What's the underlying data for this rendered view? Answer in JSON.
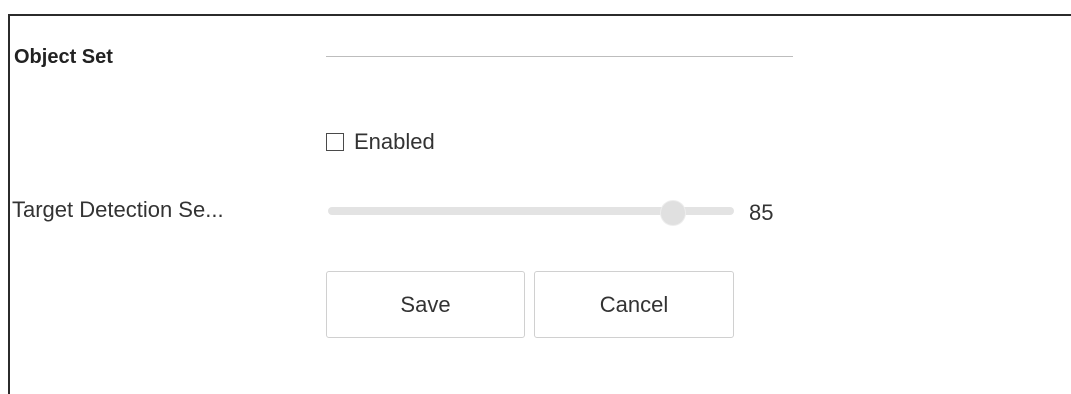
{
  "section": {
    "title": "Object Set"
  },
  "enabled": {
    "label": "Enabled",
    "checked": false
  },
  "sensitivity": {
    "label": "Target Detection Se...",
    "value": "85",
    "level": 85,
    "min": 0,
    "max": 100
  },
  "buttons": {
    "save": "Save",
    "cancel": "Cancel"
  },
  "colors": {
    "track": "#e3e3e3",
    "thumb": "#e0e0e0",
    "button_border": "#d0d0d0",
    "text": "#333333"
  }
}
